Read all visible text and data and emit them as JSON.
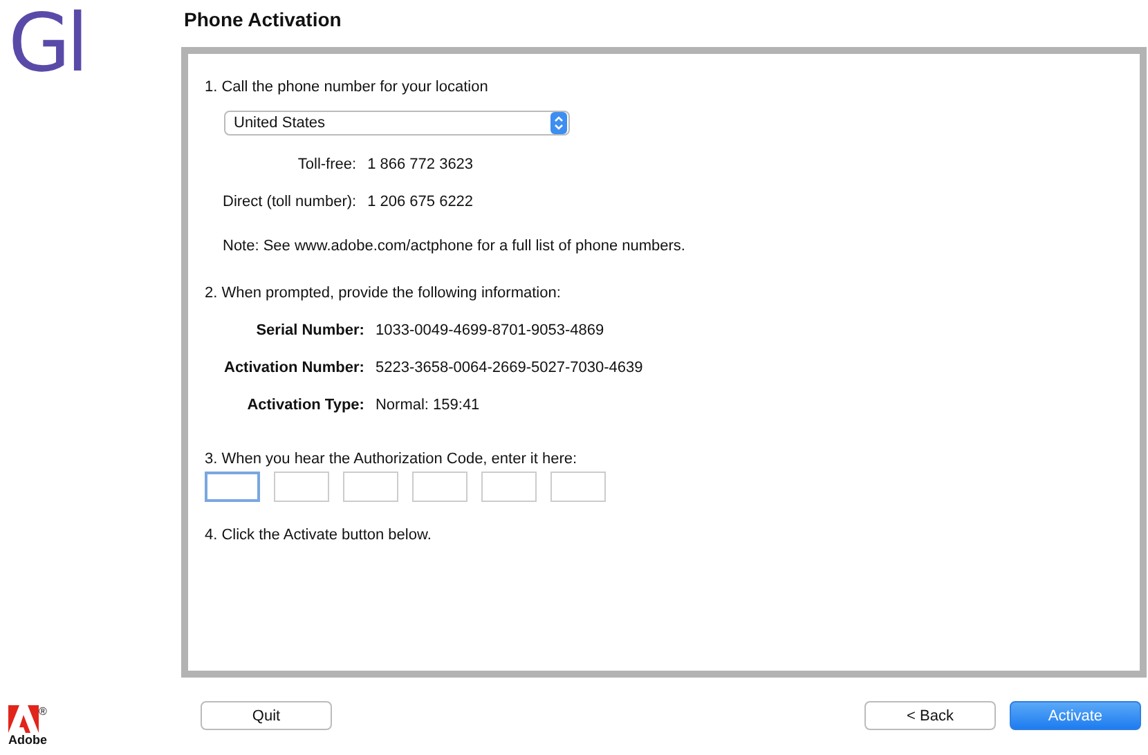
{
  "app_logo": {
    "text": "Gl"
  },
  "vendor_logo": {
    "mark": "®",
    "name": "Adobe"
  },
  "title": "Phone Activation",
  "step1": {
    "text": "1. Call the phone number for your location",
    "country": "United States",
    "phones": [
      {
        "label": "Toll-free:",
        "value": "1 866 772 3623"
      },
      {
        "label": "Direct (toll number):",
        "value": "1 206 675 6222"
      }
    ],
    "note": "Note: See www.adobe.com/actphone for a full list of phone numbers."
  },
  "step2": {
    "text": "2. When prompted, provide the following information:",
    "fields": [
      {
        "label": "Serial Number:",
        "value": "1033-0049-4699-8701-9053-4869"
      },
      {
        "label": "Activation Number:",
        "value": "5223-3658-0064-2669-5027-7030-4639"
      },
      {
        "label": "Activation Type:",
        "value": "Normal: 159:41"
      }
    ]
  },
  "step3": {
    "text": "3. When you hear the Authorization Code, enter it here:",
    "code_fields": [
      {
        "focused": true
      },
      {
        "focused": false
      },
      {
        "focused": false
      },
      {
        "focused": false
      },
      {
        "focused": false
      },
      {
        "focused": false
      }
    ]
  },
  "step4": {
    "text": "4. Click the Activate button below."
  },
  "buttons": [
    {
      "label": "Quit",
      "kind": "plain"
    },
    {
      "label": "< Back",
      "kind": "plain"
    },
    {
      "label": "Activate",
      "kind": "primary"
    }
  ]
}
